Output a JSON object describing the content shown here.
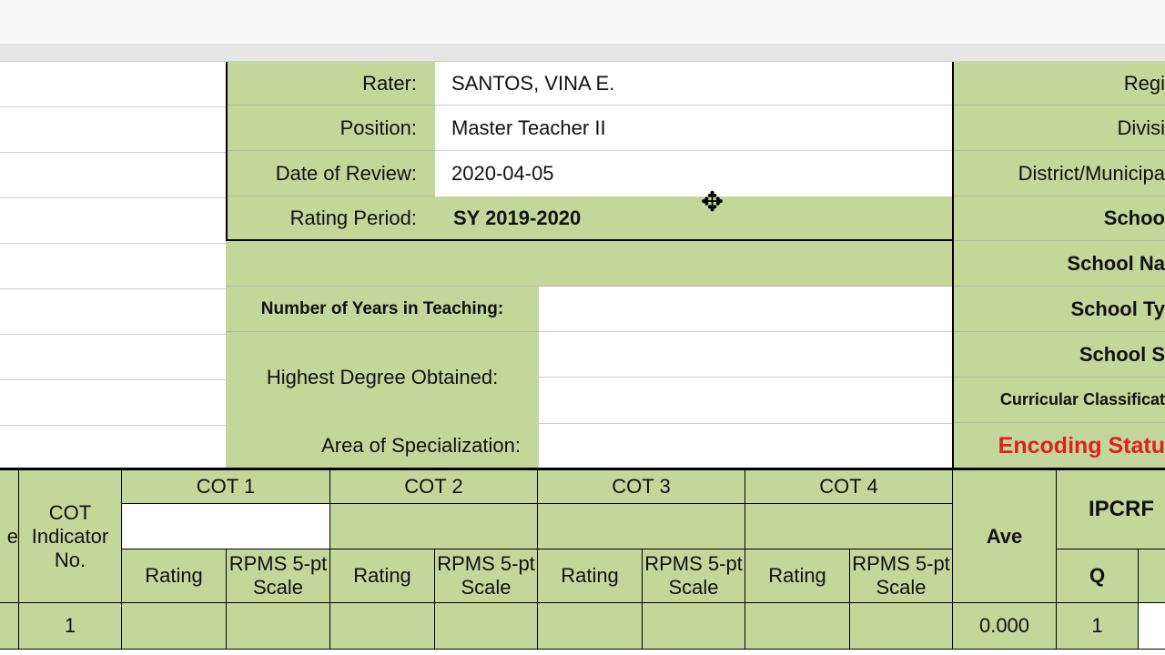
{
  "reviewer": {
    "rater_label": "Rater:",
    "rater": "SANTOS, VINA E.",
    "position_label": "Position:",
    "position": "Master Teacher II",
    "date_label": "Date of Review:",
    "date": "2020-04-05",
    "period_label": "Rating Period:",
    "period": "SY 2019-2020"
  },
  "teacher": {
    "years_label": "Number of Years in Teaching:",
    "years": "",
    "degree_label": "Highest Degree Obtained:",
    "degree": "",
    "specialization_label": "Area of Specialization:",
    "specialization": ""
  },
  "school": {
    "labels": [
      "Regi",
      "Divisi",
      "District/Municipa",
      "Schoo",
      "School Na",
      "School Ty",
      "School S",
      "Curricular Classificat"
    ],
    "encoding_status": "Encoding Statu"
  },
  "table": {
    "left_partial": "e",
    "indicator_header": "COT Indicator No.",
    "cots": [
      "COT 1",
      "COT 2",
      "COT 3",
      "COT 4"
    ],
    "rating": "Rating",
    "rpms": "RPMS 5-pt Scale",
    "ave": "Ave",
    "ipcrf": "IPCRF",
    "q": "Q",
    "rows": [
      {
        "indicator": "1",
        "ave": "0.000",
        "q": "1"
      }
    ]
  },
  "colors": {
    "green": "#c4d79b",
    "status_red": "#e02020"
  }
}
